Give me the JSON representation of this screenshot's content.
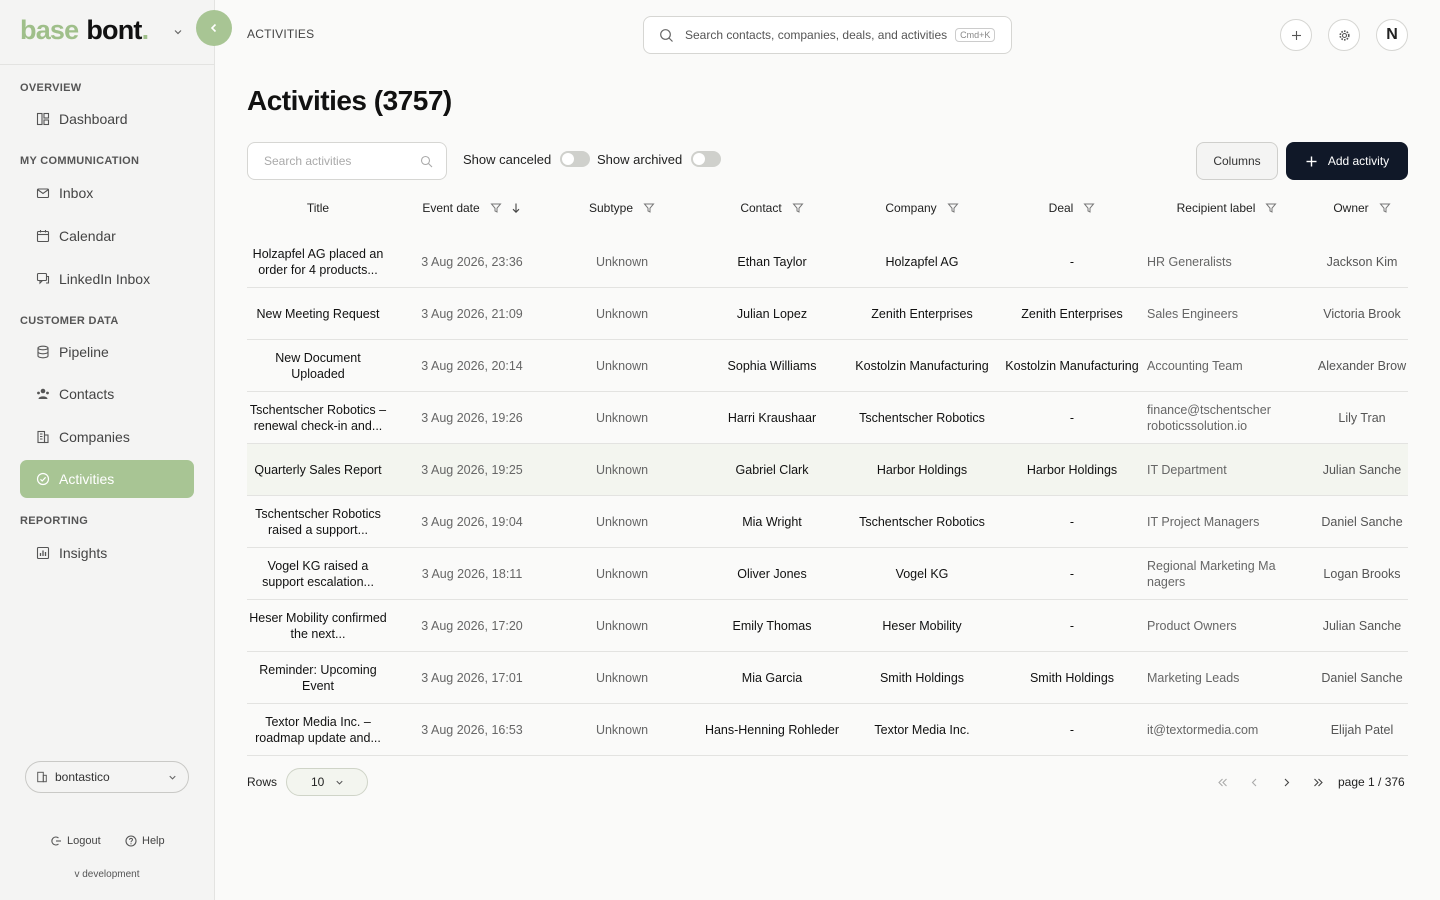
{
  "brand": {
    "part1": "base",
    "part2": "bont",
    "dot": "."
  },
  "sidebar": {
    "sections": [
      {
        "label": "OVERVIEW",
        "items": [
          {
            "label": "Dashboard",
            "icon": "dashboard-icon"
          }
        ]
      },
      {
        "label": "MY COMMUNICATION",
        "items": [
          {
            "label": "Inbox",
            "icon": "mail-icon"
          },
          {
            "label": "Calendar",
            "icon": "calendar-icon"
          },
          {
            "label": "LinkedIn Inbox",
            "icon": "chat-icon"
          }
        ]
      },
      {
        "label": "CUSTOMER DATA",
        "items": [
          {
            "label": "Pipeline",
            "icon": "database-icon"
          },
          {
            "label": "Contacts",
            "icon": "users-icon"
          },
          {
            "label": "Companies",
            "icon": "building-icon"
          },
          {
            "label": "Activities",
            "icon": "activity-icon",
            "active": true
          }
        ]
      },
      {
        "label": "REPORTING",
        "items": [
          {
            "label": "Insights",
            "icon": "chart-icon"
          }
        ]
      }
    ],
    "org": "bontastico",
    "logout": "Logout",
    "help": "Help",
    "version": "v development"
  },
  "header": {
    "breadcrumb": "ACTIVITIES",
    "search_placeholder": "Search contacts, companies, deals, and activities",
    "shortcut": "Cmd+K",
    "avatar_initial": "N"
  },
  "page": {
    "title": "Activities (3757)",
    "search_placeholder": "Search activities",
    "show_canceled": "Show canceled",
    "show_archived": "Show archived",
    "columns_button": "Columns",
    "add_button": "Add activity"
  },
  "table": {
    "columns": [
      "Title",
      "Event date",
      "Subtype",
      "Contact",
      "Company",
      "Deal",
      "Recipient label",
      "Owner"
    ],
    "rows": [
      {
        "title": "Holzapfel AG placed an order for 4 products...",
        "date": "3 Aug 2026, 23:36",
        "subtype": "Unknown",
        "contact": "Ethan Taylor",
        "company": "Holzapfel AG",
        "deal": "-",
        "recipient": "HR Generalists",
        "owner": "Jackson Kim"
      },
      {
        "title": "New Meeting Request",
        "date": "3 Aug 2026, 21:09",
        "subtype": "Unknown",
        "contact": "Julian Lopez",
        "company": "Zenith Enterprises",
        "deal": "Zenith Enterprises",
        "recipient": "Sales Engineers",
        "owner": "Victoria Brook"
      },
      {
        "title": "New Document Uploaded",
        "date": "3 Aug 2026, 20:14",
        "subtype": "Unknown",
        "contact": "Sophia Williams",
        "company": "Kostolzin Manufacturing",
        "deal": "Kostolzin Manufacturing",
        "recipient": "Accounting Team",
        "owner": "Alexander Brow"
      },
      {
        "title": "Tschentscher Robotics – renewal check-in and...",
        "date": "3 Aug 2026, 19:26",
        "subtype": "Unknown",
        "contact": "Harri Kraushaar",
        "company": "Tschentscher Robotics",
        "deal": "-",
        "recipient": "finance@tschentscher roboticssolution.io",
        "owner": "Lily Tran"
      },
      {
        "title": "Quarterly Sales Report",
        "date": "3 Aug 2026, 19:25",
        "subtype": "Unknown",
        "contact": "Gabriel Clark",
        "company": "Harbor Holdings",
        "deal": "Harbor Holdings",
        "recipient": "IT Department",
        "owner": "Julian Sanche"
      },
      {
        "title": "Tschentscher Robotics raised a support...",
        "date": "3 Aug 2026, 19:04",
        "subtype": "Unknown",
        "contact": "Mia Wright",
        "company": "Tschentscher Robotics",
        "deal": "-",
        "recipient": "IT Project Managers",
        "owner": "Daniel Sanche"
      },
      {
        "title": "Vogel KG raised a support escalation...",
        "date": "3 Aug 2026, 18:11",
        "subtype": "Unknown",
        "contact": "Oliver Jones",
        "company": "Vogel KG",
        "deal": "-",
        "recipient": "Regional Marketing Ma nagers",
        "owner": "Logan Brooks"
      },
      {
        "title": "Heser Mobility confirmed the next...",
        "date": "3 Aug 2026, 17:20",
        "subtype": "Unknown",
        "contact": "Emily Thomas",
        "company": "Heser Mobility",
        "deal": "-",
        "recipient": "Product Owners",
        "owner": "Julian Sanche"
      },
      {
        "title": "Reminder: Upcoming Event",
        "date": "3 Aug 2026, 17:01",
        "subtype": "Unknown",
        "contact": "Mia Garcia",
        "company": "Smith Holdings",
        "deal": "Smith Holdings",
        "recipient": "Marketing Leads",
        "owner": "Daniel Sanche"
      },
      {
        "title": "Textor Media Inc. – roadmap update and...",
        "date": "3 Aug 2026, 16:53",
        "subtype": "Unknown",
        "contact": "Hans-Henning Rohleder",
        "company": "Textor Media Inc.",
        "deal": "-",
        "recipient": "it@textormedia.com",
        "owner": "Elijah Patel"
      }
    ]
  },
  "pagination": {
    "rows_label": "Rows",
    "rows_value": "10",
    "page_info": "page 1 / 376"
  },
  "colors": {
    "accent": "#a8c594",
    "primary": "#101828",
    "highlight_row": "#f3f5ef"
  }
}
